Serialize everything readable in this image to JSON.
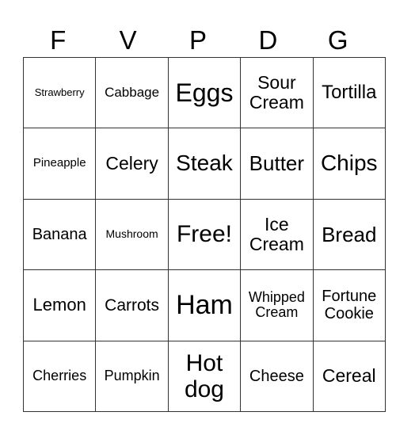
{
  "header": [
    "F",
    "V",
    "P",
    "D",
    "G"
  ],
  "rows": [
    [
      {
        "t": "Strawberry",
        "s": 13
      },
      {
        "t": "Cabbage",
        "s": 17
      },
      {
        "t": "Eggs",
        "s": 32
      },
      {
        "t": "Sour Cream",
        "s": 23
      },
      {
        "t": "Tortilla",
        "s": 24
      }
    ],
    [
      {
        "t": "Pineapple",
        "s": 15
      },
      {
        "t": "Celery",
        "s": 23
      },
      {
        "t": "Steak",
        "s": 28
      },
      {
        "t": "Butter",
        "s": 26
      },
      {
        "t": "Chips",
        "s": 28
      }
    ],
    [
      {
        "t": "Banana",
        "s": 20
      },
      {
        "t": "Mushroom",
        "s": 14
      },
      {
        "t": "Free!",
        "s": 30
      },
      {
        "t": "Ice Cream",
        "s": 23
      },
      {
        "t": "Bread",
        "s": 26
      }
    ],
    [
      {
        "t": "Lemon",
        "s": 22
      },
      {
        "t": "Carrots",
        "s": 21
      },
      {
        "t": "Ham",
        "s": 34
      },
      {
        "t": "Whipped Cream",
        "s": 18
      },
      {
        "t": "Fortune Cookie",
        "s": 20
      }
    ],
    [
      {
        "t": "Cherries",
        "s": 18
      },
      {
        "t": "Pumpkin",
        "s": 18
      },
      {
        "t": "Hot dog",
        "s": 30
      },
      {
        "t": "Cheese",
        "s": 20
      },
      {
        "t": "Cereal",
        "s": 23
      }
    ]
  ]
}
